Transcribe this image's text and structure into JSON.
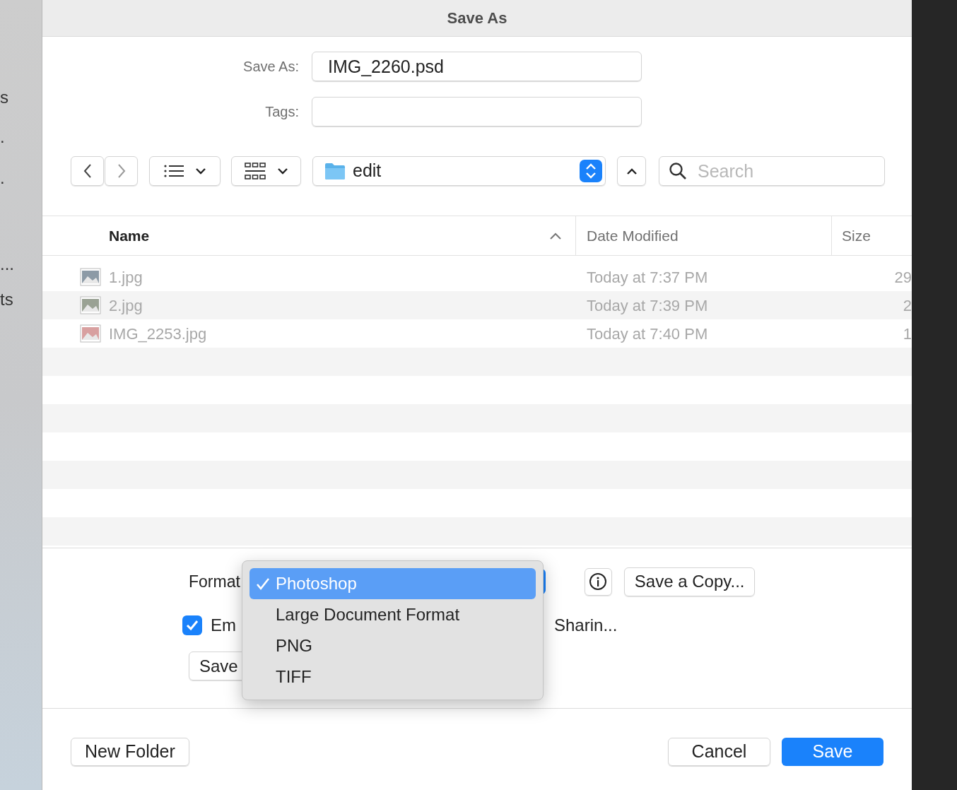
{
  "background_fragments": [
    "s",
    ".",
    ".",
    "...",
    "ts"
  ],
  "window": {
    "title": "Save As"
  },
  "save_as": {
    "label": "Save As:",
    "value": "IMG_2260.psd"
  },
  "tags": {
    "label": "Tags:"
  },
  "toolbar": {
    "location": "edit",
    "search": {
      "placeholder": "Search"
    }
  },
  "table": {
    "columns": [
      {
        "label": "Name",
        "sorted": true
      },
      {
        "label": "Date Modified",
        "sorted": false
      },
      {
        "label": "Size",
        "sorted": false
      }
    ],
    "rows": [
      {
        "name": "1.jpg",
        "modified": "Today at 7:37 PM",
        "size": "29",
        "dimmed": true
      },
      {
        "name": "2.jpg",
        "modified": "Today at 7:39 PM",
        "size": "2",
        "dimmed": true
      },
      {
        "name": "IMG_2253.jpg",
        "modified": "Today at 7:40 PM",
        "size": "1",
        "dimmed": true
      }
    ]
  },
  "options": {
    "format_label": "Format",
    "embed": {
      "label_start": "Em",
      "label_end": "Sharin...",
      "checked": true
    },
    "save_button": "Save",
    "save_copy": "Save a Copy..."
  },
  "format_menu": [
    {
      "label": "Photoshop",
      "selected": true
    },
    {
      "label": "Large Document Format",
      "selected": false
    },
    {
      "label": "PNG",
      "selected": false
    },
    {
      "label": "TIFF",
      "selected": false
    }
  ],
  "footer": {
    "new_folder": "New Folder",
    "cancel": "Cancel",
    "save": "Save"
  }
}
